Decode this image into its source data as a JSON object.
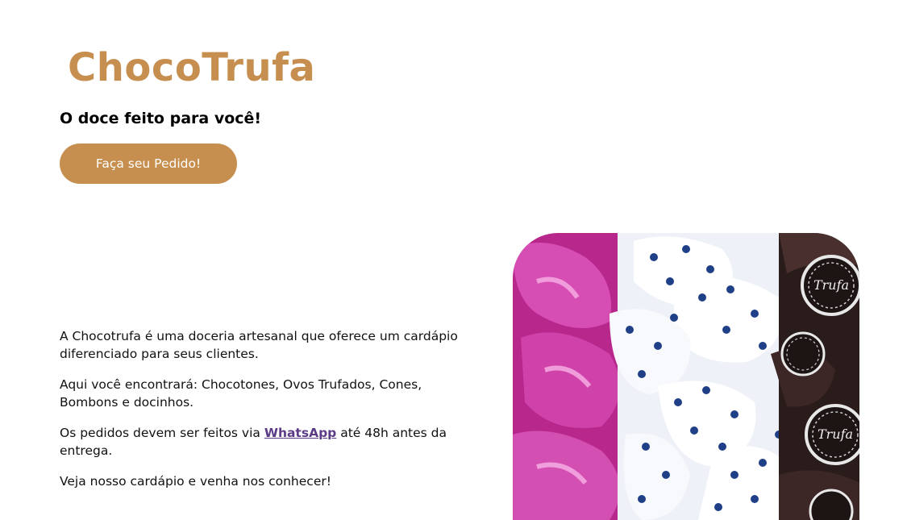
{
  "header": {
    "brand": "ChocoTrufa",
    "tagline": "O doce feito para você!",
    "order_button": "Faça seu Pedido!"
  },
  "about": {
    "p1": "A Chocotrufa é uma doceria artesanal que oferece um cardápio diferenciado para seus clientes.",
    "p2": "Aqui você encontrará: Chocotones, Ovos Trufados, Cones, Bombons e docinhos.",
    "p3_before": "Os pedidos devem ser feitos via ",
    "p3_link": "WhatsApp",
    "p3_after": " até 48h antes da entrega.",
    "p4": "Veja nosso cardápio e venha nos conhecer!"
  },
  "photo": {
    "wrapper_text": "Trufa"
  },
  "colors": {
    "brand": "#c68f4f",
    "link": "#5b3a86",
    "foil_pink": "#c8349e",
    "dot_blue": "#1f3f87",
    "chocolate": "#2b1c1c"
  }
}
